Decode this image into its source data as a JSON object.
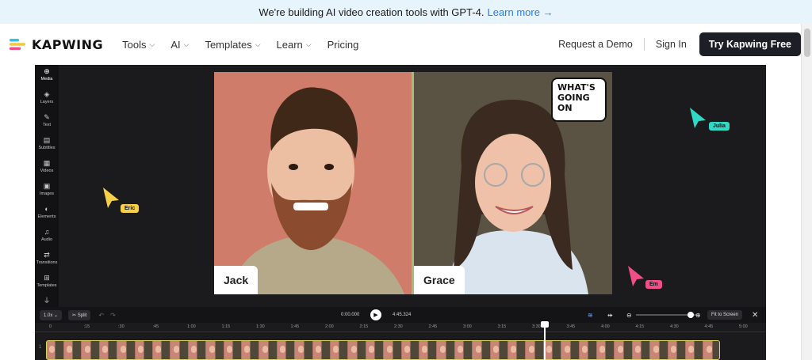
{
  "banner": {
    "text": "We're building AI video creation tools with GPT-4.",
    "link": "Learn more →"
  },
  "nav": {
    "logo_text": "KAPWING",
    "menu": [
      {
        "label": "Tools",
        "has_dropdown": true
      },
      {
        "label": "AI",
        "has_dropdown": true
      },
      {
        "label": "Templates",
        "has_dropdown": true
      },
      {
        "label": "Learn",
        "has_dropdown": true
      },
      {
        "label": "Pricing",
        "has_dropdown": false
      }
    ],
    "request_demo": "Request a Demo",
    "sign_in": "Sign In",
    "cta": "Try Kapwing Free"
  },
  "toolbar": {
    "items": [
      {
        "label": "Media",
        "icon": "plus-icon"
      },
      {
        "label": "Layers",
        "icon": "layers-icon"
      },
      {
        "label": "Text",
        "icon": "text-icon"
      },
      {
        "label": "Subtitles",
        "icon": "subtitles-icon"
      },
      {
        "label": "Videos",
        "icon": "film-icon"
      },
      {
        "label": "Images",
        "icon": "image-icon"
      },
      {
        "label": "Elements",
        "icon": "shapes-icon"
      },
      {
        "label": "Audio",
        "icon": "music-icon"
      },
      {
        "label": "Transitions",
        "icon": "transition-icon"
      },
      {
        "label": "Templates",
        "icon": "grid-icon"
      }
    ]
  },
  "canvas": {
    "left_name": "Jack",
    "right_name": "Grace",
    "bubble": [
      "WHAT'S",
      "GOING",
      "ON"
    ]
  },
  "collaborators": [
    {
      "name": "Eric",
      "color": "#f6d04a"
    },
    {
      "name": "Julia",
      "color": "#2fd9c6"
    },
    {
      "name": "Em",
      "color": "#ef4f87"
    }
  ],
  "timeline": {
    "speed": "1.0x",
    "split_label": "Split",
    "current_time": "0:00.000",
    "duration": "4:45.324",
    "fit_label": "Fit to Screen",
    "ticks": [
      "0",
      ":15",
      ":30",
      ":45",
      "1:00",
      "1:15",
      "1:30",
      "1:45",
      "2:00",
      "2:15",
      "2:30",
      "2:45",
      "3:00",
      "3:15",
      "3:30",
      "3:45",
      "4:00",
      "4:15",
      "4:30",
      "4:45",
      "5:00"
    ],
    "track_number": "1",
    "zoom_level": 0.88
  },
  "colors": {
    "accent": "#2a7de1",
    "editor_bg": "#1b1b1d",
    "cta_bg": "#1c1f26"
  }
}
